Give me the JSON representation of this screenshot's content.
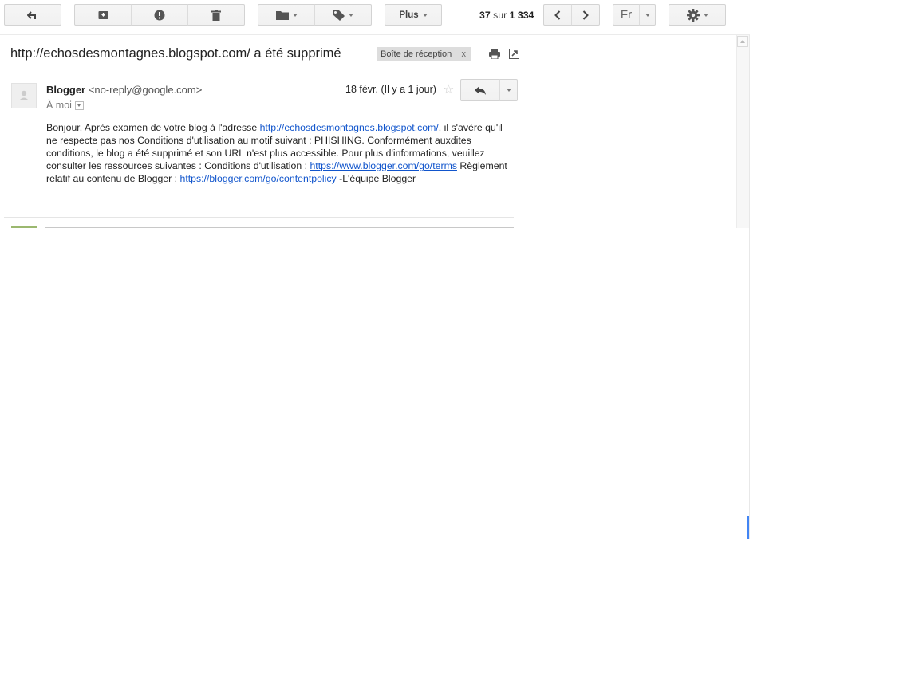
{
  "toolbar": {
    "more_label": "Plus",
    "pager": {
      "current": "37",
      "sep": "sur",
      "total": "1 334"
    },
    "language_label": "Fr"
  },
  "thread": {
    "subject": "http://echosdesmontagnes.blogspot.com/ a été supprimé",
    "label": "Boîte de réception",
    "label_remove": "x"
  },
  "message": {
    "sender_name": "Blogger",
    "sender_email": "<no-reply@google.com>",
    "recipient": "À moi",
    "date": "18 févr. (Il y a 1 jour)",
    "body": {
      "p1": "Bonjour, Après examen de votre blog à l'adresse ",
      "link1": "http://echosdesmontagnes.blogspot.com/",
      "p2": ", il s'avère qu'il ne respecte pas nos Conditions d'utilisation au motif suivant : PHISHING. Conformément auxdites conditions, le blog a été supprimé et son URL n'est plus accessible. Pour plus d'informations, veuillez consulter les ressources suivantes : Conditions d'utilisation : ",
      "link2": "https://www.blogger.com/go/terms",
      "p3": " Règlement relatif au contenu de Blogger : ",
      "link3": "https://blogger.com/go/contentpolicy",
      "p4": " -L'équipe Blogger"
    }
  },
  "icons": {
    "back": "back-arrow-icon",
    "archive": "archive-icon",
    "spam": "report-spam-icon",
    "delete": "trash-icon",
    "move": "folder-icon",
    "labels": "label-tag-icon",
    "prev": "chevron-left-icon",
    "next": "chevron-right-icon",
    "settings": "gear-icon",
    "print": "print-icon",
    "new_window": "new-window-icon",
    "star": "star-icon",
    "reply": "reply-icon"
  }
}
